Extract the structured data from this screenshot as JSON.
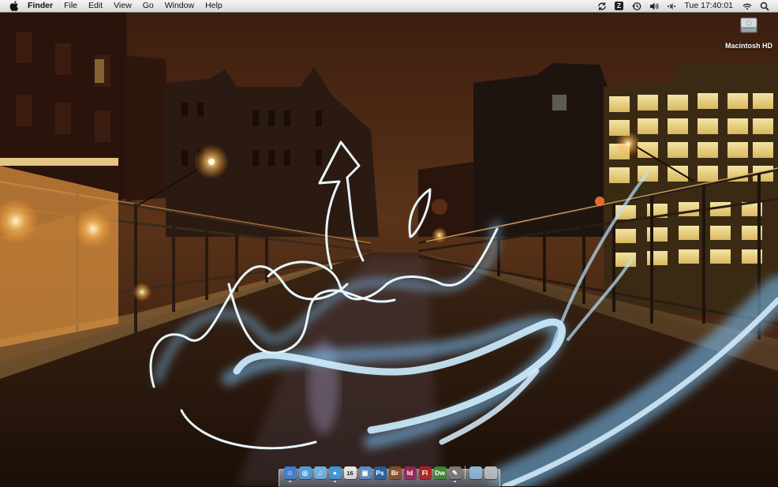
{
  "menubar": {
    "apple_icon": "apple-logo-icon",
    "app_name": "Finder",
    "menus": [
      "File",
      "Edit",
      "View",
      "Go",
      "Window",
      "Help"
    ],
    "status": {
      "sync_icon": "sync-icon",
      "input_badge": "Z",
      "time_machine_icon": "time-machine-icon",
      "volume_icon": "volume-icon",
      "bluetooth_icon": "bluetooth-icon",
      "clock": "Tue 17:40:01",
      "wifi_icon": "wifi-icon",
      "spotlight_icon": "spotlight-icon"
    }
  },
  "desktop": {
    "icons": [
      {
        "label": "Macintosh HD",
        "icon": "hard-drive-icon"
      }
    ]
  },
  "dock": {
    "items": [
      {
        "name": "finder",
        "glyph": "☺",
        "color": "#3d7fd6",
        "running": true
      },
      {
        "name": "safari",
        "glyph": "◎",
        "color": "#4aa0e0",
        "running": false
      },
      {
        "name": "itunes",
        "glyph": "♫",
        "color": "#6fb3e8",
        "running": false
      },
      {
        "name": "ichat",
        "glyph": "●",
        "color": "#3f98d9",
        "running": true
      },
      {
        "name": "ical",
        "glyph": "16",
        "color": "#e8e8e8",
        "running": false
      },
      {
        "name": "preview",
        "glyph": "▣",
        "color": "#5e8fc4",
        "running": false
      },
      {
        "name": "photoshop",
        "glyph": "Ps",
        "color": "#1f5fa0",
        "running": false
      },
      {
        "name": "bridge",
        "glyph": "Br",
        "color": "#8a4a1f",
        "running": false
      },
      {
        "name": "indesign",
        "glyph": "Id",
        "color": "#9a1f5a",
        "running": false
      },
      {
        "name": "flash",
        "glyph": "Fl",
        "color": "#b01d1d",
        "running": false
      },
      {
        "name": "dreamweaver",
        "glyph": "Dw",
        "color": "#3c8a2a",
        "running": false
      },
      {
        "name": "script-editor",
        "glyph": "✎",
        "color": "#7a7a7a",
        "running": true
      },
      {
        "name": "documents-folder",
        "glyph": "",
        "color": "#8fb7dd",
        "running": false
      },
      {
        "name": "trash",
        "glyph": "",
        "color": "#b8bec4",
        "running": false
      }
    ]
  }
}
